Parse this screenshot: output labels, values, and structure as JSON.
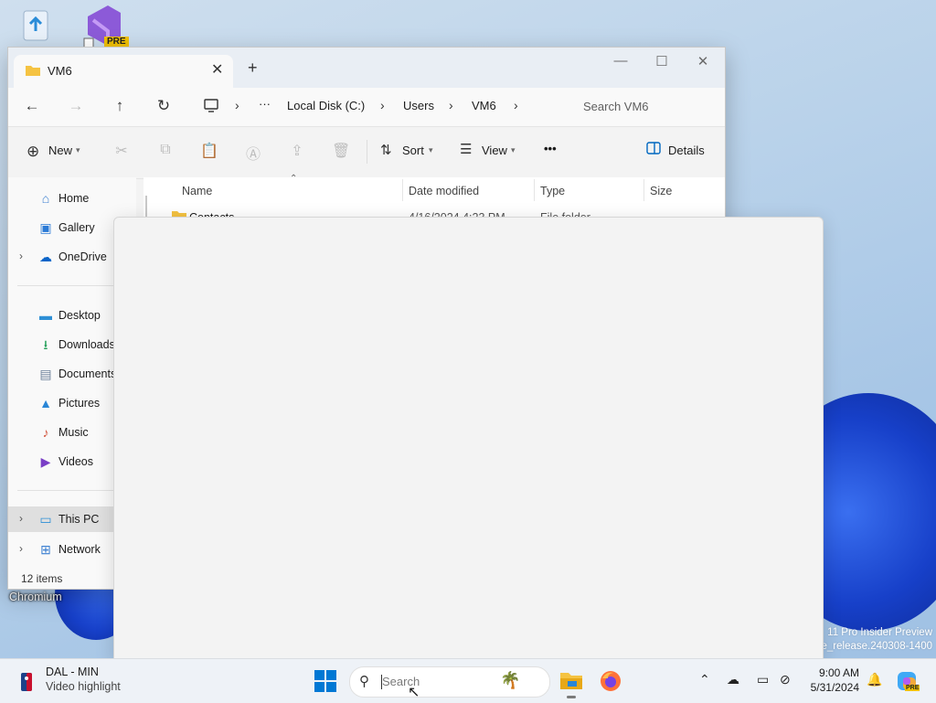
{
  "desktop": {
    "shortcut_label": "Chromium",
    "watermark_line1": "11 Pro Insider Preview",
    "watermark_line2": "ge_release.240308-1400",
    "vs_badge": "PRE"
  },
  "explorer": {
    "tab_title": "VM6",
    "breadcrumb": [
      "Local Disk (C:)",
      "Users",
      "VM6"
    ],
    "search_placeholder": "Search VM6",
    "commands": {
      "new": "New",
      "sort": "Sort",
      "view": "View",
      "more": "•••",
      "details": "Details"
    },
    "nav": [
      {
        "label": "Home",
        "icon": "home-icon"
      },
      {
        "label": "Gallery",
        "icon": "gallery-icon"
      },
      {
        "label": "OneDrive",
        "icon": "cloud-icon"
      },
      {
        "label": "Desktop",
        "icon": "desktop-icon"
      },
      {
        "label": "Downloads",
        "icon": "download-icon"
      },
      {
        "label": "Documents",
        "icon": "document-icon"
      },
      {
        "label": "Pictures",
        "icon": "pictures-icon"
      },
      {
        "label": "Music",
        "icon": "music-icon"
      },
      {
        "label": "Videos",
        "icon": "videos-icon"
      },
      {
        "label": "This PC",
        "icon": "pc-icon"
      },
      {
        "label": "Network",
        "icon": "network-icon"
      }
    ],
    "columns": [
      "Name",
      "Date modified",
      "Type",
      "Size"
    ],
    "rows": [
      {
        "name": "Contacts",
        "date": "4/16/2024 4:23 PM",
        "type": "File folder",
        "size": ""
      }
    ],
    "status": "12 items"
  },
  "taskbar": {
    "widget_title": "DAL - MIN",
    "widget_subtitle": "Video highlight",
    "search_placeholder": "Search",
    "time": "9:00 AM",
    "date": "5/31/2024"
  },
  "colors": {
    "accent": "#0067c0",
    "folder": "#f5c342",
    "bloom": "#1740c9"
  }
}
